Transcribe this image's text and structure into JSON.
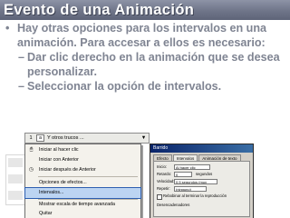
{
  "title": "Evento de una Animación",
  "bullets": {
    "main_mark": "•",
    "main": "Hay otras opciones para los intervalos en una animación. Para accesar a ellos es necesario:",
    "sub_mark": "–",
    "sub": [
      "Dar clic derecho en la animación que se desea personalizar.",
      "Seleccionar la opción de intervalos."
    ]
  },
  "strip": {
    "number": "1",
    "icon_letter": "a",
    "label": "Y otros trucos ...",
    "arrow": "▼"
  },
  "menu": {
    "items": [
      {
        "label": "Iniciar al hacer clic",
        "icon": "🖱",
        "underline": "c"
      },
      {
        "label": "Iniciar con Anterior",
        "icon": "",
        "underline": "A"
      },
      {
        "label": "Iniciar después de Anterior",
        "icon": "◷",
        "underline": "d"
      },
      {
        "label": "Opciones de efectos...",
        "icon": "",
        "underline": "e"
      },
      {
        "label": "Intervalos...",
        "icon": "",
        "underline": "I"
      },
      {
        "label": "Mostrar escala de tiempo avanzada",
        "icon": "",
        "underline": "M"
      },
      {
        "label": "Quitar",
        "icon": "",
        "underline": "Q"
      }
    ]
  },
  "dialog": {
    "title": "Barrido",
    "tabs": [
      "Efecto",
      "Intervalos",
      "Animación de texto"
    ],
    "rows": [
      {
        "label": "Inicio:",
        "value": "Al hacer clic"
      },
      {
        "label": "Retardo:",
        "value": "0",
        "unit": "segundos"
      },
      {
        "label": "Velocidad:",
        "value": "0,5 segundos (muy rápido)"
      },
      {
        "label": "Repetir:",
        "value": "(ninguno)"
      },
      {
        "label": "Rebobinar al terminar la reproducción",
        "value": ""
      },
      {
        "label": "Desencadenadores",
        "value": ""
      }
    ]
  }
}
